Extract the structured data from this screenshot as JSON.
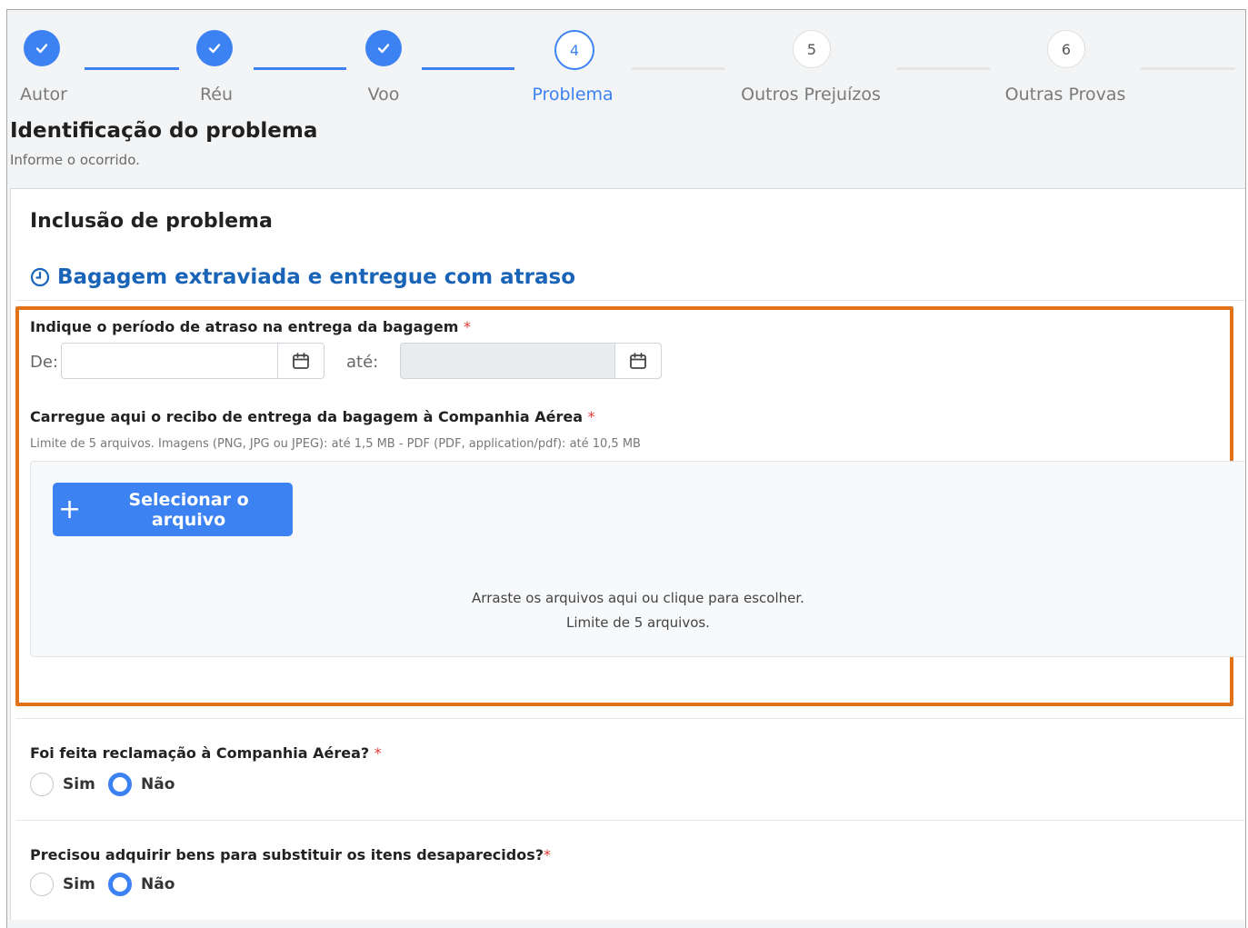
{
  "stepper": {
    "steps": [
      {
        "label": "Autor",
        "number": "",
        "state": "done"
      },
      {
        "label": "Réu",
        "number": "",
        "state": "done"
      },
      {
        "label": "Voo",
        "number": "",
        "state": "done"
      },
      {
        "label": "Problema",
        "number": "4",
        "state": "active"
      },
      {
        "label": "Outros Prejuízos",
        "number": "5",
        "state": "todo"
      },
      {
        "label": "Outras Provas",
        "number": "6",
        "state": "todo"
      }
    ]
  },
  "header": {
    "title": "Identificação do problema",
    "subtitle": "Informe o ocorrido."
  },
  "card": {
    "title": "Inclusão de problema",
    "section_title": "Bagagem extraviada e entregue com atraso",
    "section_icon": "clock-icon"
  },
  "delay_period": {
    "label": "Indique o período de atraso na entrega da bagagem",
    "required_mark": "*",
    "from_label": "De:",
    "from_value": "",
    "to_label": "até:",
    "to_value": ""
  },
  "receipt_upload": {
    "label": "Carregue aqui o recibo de entrega da bagagem à Companhia Aérea",
    "required_mark": "*",
    "hint": "Limite de 5 arquivos. Imagens (PNG, JPG ou JPEG): até 1,5 MB - PDF (PDF, application/pdf): até 10,5 MB",
    "button_label": "Selecionar o arquivo",
    "drop_text_1": "Arraste os arquivos aqui ou clique para escolher.",
    "drop_text_2": "Limite de 5 arquivos."
  },
  "complaint_question": {
    "label": "Foi feita reclamação à Companhia Aérea?",
    "required_mark": "*",
    "option_yes": "Sim",
    "option_no": "Não",
    "selected": "Não"
  },
  "replacement_question": {
    "label": "Precisou adquirir bens para substituir os itens desaparecidos?",
    "required_mark": "*",
    "option_yes": "Sim",
    "option_no": "Não",
    "selected": "Não"
  },
  "colors": {
    "accent": "#3c82f3",
    "section_title": "#1a64b8",
    "highlight": "#e07318",
    "required": "#e53935"
  }
}
